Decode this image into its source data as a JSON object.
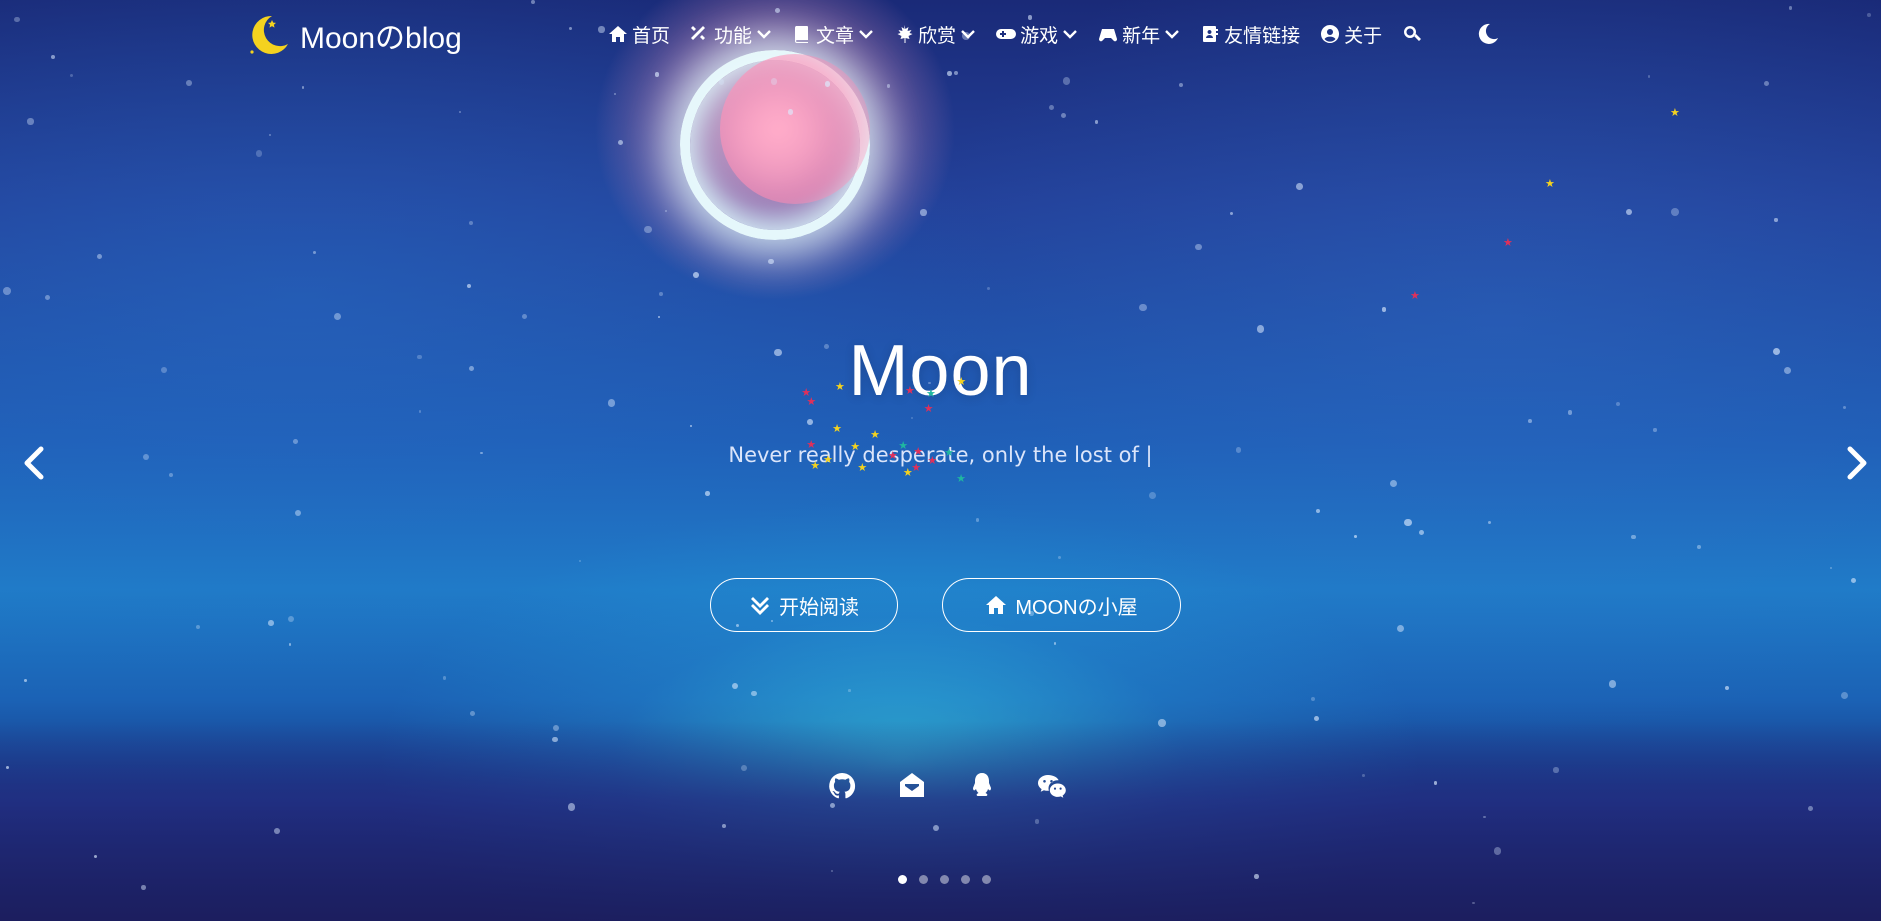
{
  "site": {
    "title": "Moonのblog"
  },
  "nav": {
    "items": [
      {
        "label": "首页",
        "icon": "home-icon",
        "dropdown": false
      },
      {
        "label": "功能",
        "icon": "tools-icon",
        "dropdown": true
      },
      {
        "label": "文章",
        "icon": "book-icon",
        "dropdown": true
      },
      {
        "label": "欣赏",
        "icon": "leaf-icon",
        "dropdown": true
      },
      {
        "label": "游戏",
        "icon": "gamepad-icon",
        "dropdown": true
      },
      {
        "label": "新年",
        "icon": "controller-icon",
        "dropdown": true
      },
      {
        "label": "友情链接",
        "icon": "address-book-icon",
        "dropdown": false
      },
      {
        "label": "关于",
        "icon": "user-circle-icon",
        "dropdown": false
      }
    ],
    "search_icon": "search-icon",
    "theme_icon": "moon-icon"
  },
  "hero": {
    "title": "Moon",
    "subtitle": "Never really desperate, only the lost of |",
    "buttons": {
      "read": "开始阅读",
      "home": "MOONの小屋"
    }
  },
  "socials": [
    "github-icon",
    "mail-icon",
    "qq-icon",
    "wechat-icon"
  ],
  "carousel": {
    "slide_count": 5,
    "active_index": 0
  },
  "colors": {
    "logo_moon": "#f4d21f",
    "text": "#ffffff"
  }
}
